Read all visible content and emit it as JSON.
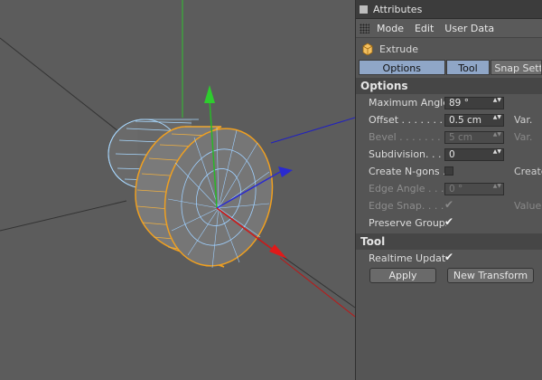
{
  "panel": {
    "title": "Attributes",
    "menu": [
      "Mode",
      "Edit",
      "User Data"
    ],
    "object_name": "Extrude",
    "tabs": [
      {
        "label": "Options",
        "active": true
      },
      {
        "label": "Tool",
        "active": true
      },
      {
        "label": "Snap Settings",
        "active": false
      }
    ],
    "options_header": "Options",
    "max_angle": {
      "label": "Maximum Angle",
      "value": "89 °"
    },
    "offset": {
      "label": "Offset . . . . . . . .",
      "value": "0.5 cm",
      "var": "Var."
    },
    "bevel": {
      "label": "Bevel . . . . . . . .",
      "value": "5 cm",
      "var": "Var."
    },
    "subdivision": {
      "label": "Subdivision. . . .",
      "value": "0"
    },
    "create_ngons": {
      "label": "Create N-gons .",
      "checked": false,
      "side": "Create"
    },
    "edge_angle": {
      "label": "Edge Angle . . .",
      "value": "0 °"
    },
    "edge_snap": {
      "label": "Edge Snap. . . .",
      "checked": true,
      "side": "Value"
    },
    "preserve_groups": {
      "label": "Preserve Groups",
      "checked": true
    },
    "tool_header": "Tool",
    "realtime_update": {
      "label": "Realtime Update",
      "checked": true
    },
    "apply_label": "Apply",
    "new_transform_label": "New Transform"
  },
  "icons": {
    "check": "✔",
    "spin": "▲▼"
  },
  "colors": {
    "tab_active": "#8fa6c7",
    "selection_orange": "#f0a020",
    "wire_blue": "#9fd0ff",
    "axis_y": "#1faa1f",
    "axis_x": "#cc1515",
    "axis_z": "#1a1acc"
  }
}
